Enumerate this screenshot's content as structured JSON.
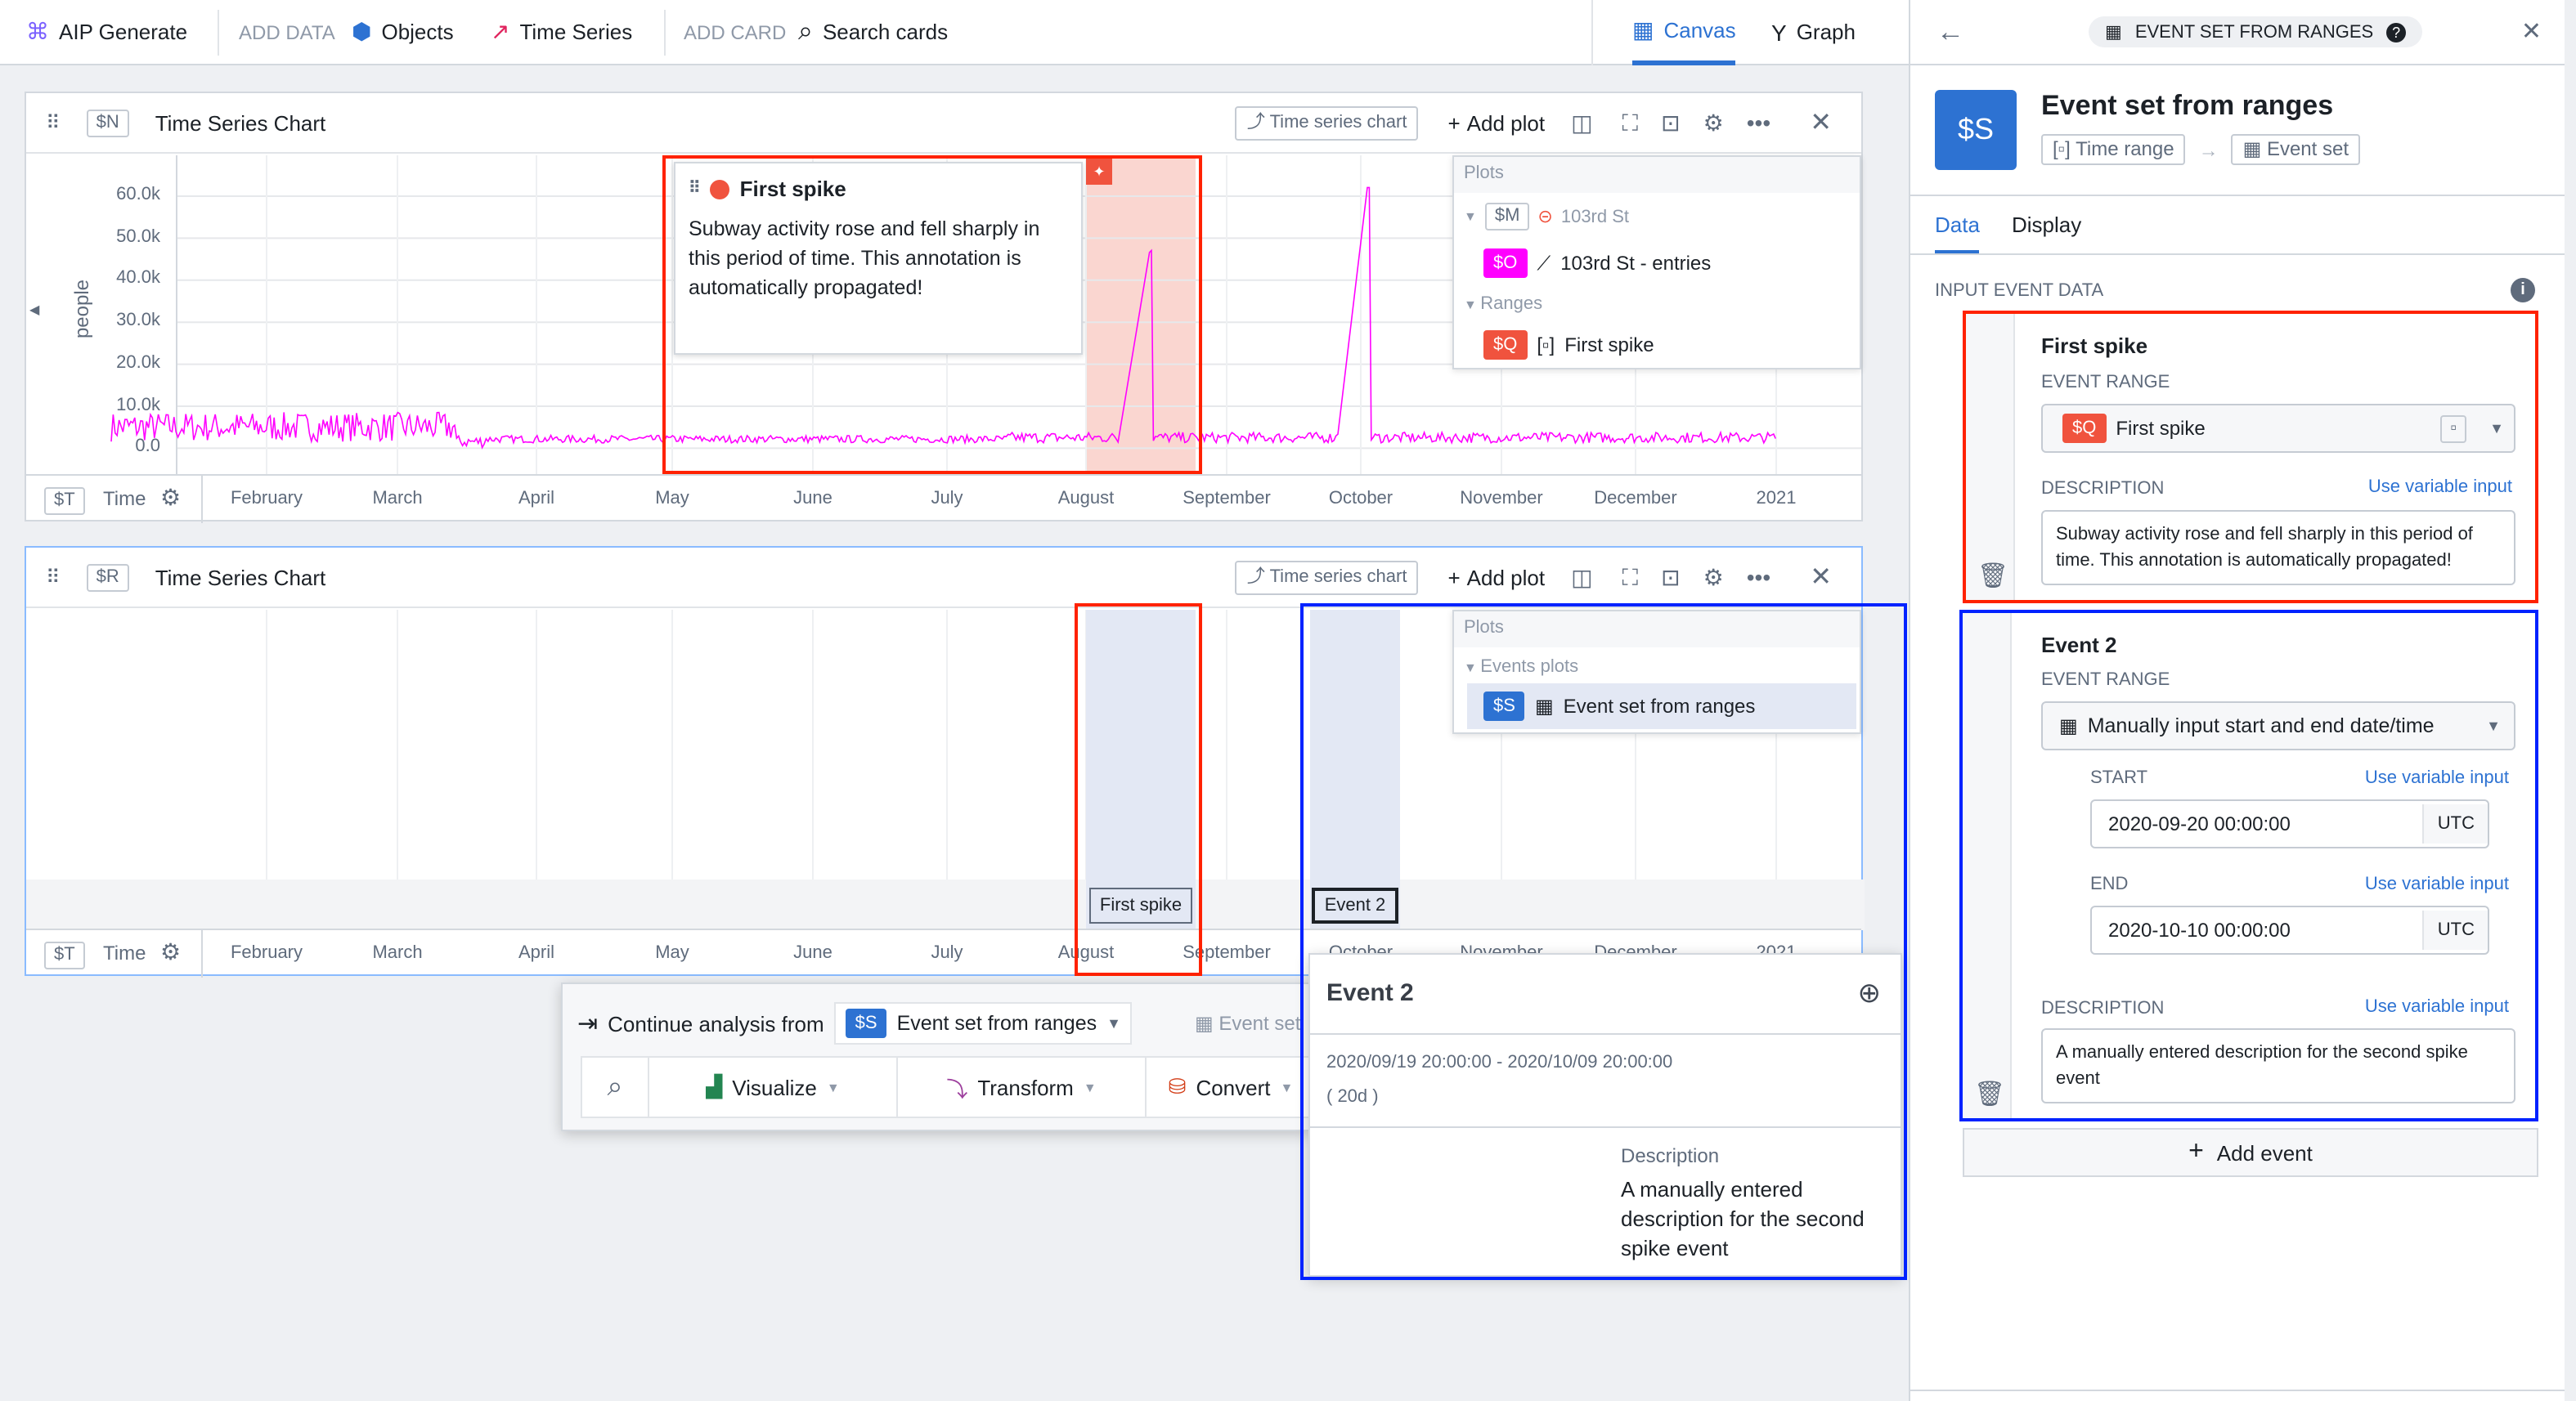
{
  "topbar": {
    "aip": "AIP Generate",
    "add_data": "ADD DATA",
    "objects": "Objects",
    "time_series": "Time Series",
    "add_card": "ADD CARD",
    "search_cards": "Search cards",
    "canvas": "Canvas",
    "graph": "Graph"
  },
  "colors": {
    "accent": "#2d72d2",
    "series": "#ff00ff",
    "range_red": "#f0533e",
    "highlight_red": "#ff2200",
    "highlight_blue": "#0022ff"
  },
  "card1": {
    "id": "$N",
    "title": "Time Series Chart",
    "type_btn": "Time series chart",
    "add_plot": "Add plot",
    "y_axis_label": "people",
    "y_ticks": [
      "60.0k",
      "50.0k",
      "40.0k",
      "30.0k",
      "20.0k",
      "10.0k",
      "0.0"
    ],
    "time_id": "$T",
    "time_label": "Time",
    "months": [
      "February",
      "March",
      "April",
      "May",
      "June",
      "July",
      "August",
      "September",
      "October",
      "November",
      "December",
      "2021"
    ],
    "annotation": {
      "title": "First spike",
      "text": "Subway activity rose and fell sharply in this period of time. This annotation is automatically propagated!"
    },
    "legend": {
      "header": "Plots",
      "group_id": "$M",
      "group_name": "103rd St",
      "series_id": "$O",
      "series_name": "103rd St - entries",
      "ranges_header": "Ranges",
      "range_id": "$Q",
      "range_name": "First spike"
    }
  },
  "card2": {
    "id": "$R",
    "title": "Time Series Chart",
    "type_btn": "Time series chart",
    "add_plot": "Add plot",
    "time_id": "$T",
    "time_label": "Time",
    "months": [
      "February",
      "March",
      "April",
      "May",
      "June",
      "July",
      "August",
      "September",
      "October",
      "November",
      "December",
      "2021"
    ],
    "legend": {
      "header": "Plots",
      "events_header": "Events plots",
      "series_id": "$S",
      "series_name": "Event set from ranges"
    },
    "event_labels": [
      "First spike",
      "Event 2"
    ]
  },
  "continue": {
    "label": "Continue analysis from",
    "id": "$S",
    "value": "Event set from ranges",
    "type": "Event set",
    "visualize": "Visualize",
    "transform": "Transform",
    "convert": "Convert"
  },
  "event_popup": {
    "title": "Event 2",
    "range": "2020/09/19 20:00:00 - 2020/10/09 20:00:00",
    "duration": "( 20d )",
    "desc_label": "Description",
    "desc": "A manually entered description for the second spike event"
  },
  "panel": {
    "crumb": "EVENT SET FROM RANGES",
    "id": "$S",
    "title": "Event set from ranges",
    "input_type": "Time range",
    "output_type": "Event set",
    "tabs": [
      "Data",
      "Display"
    ],
    "section": "INPUT EVENT DATA",
    "events": [
      {
        "name": "First spike",
        "range_label": "EVENT RANGE",
        "range_id": "$Q",
        "range_value": "First spike",
        "desc_label": "DESCRIPTION",
        "use_var": "Use variable input",
        "desc": "Subway activity rose and fell sharply in this period of time. This annotation is automatically propagated!"
      },
      {
        "name": "Event 2",
        "range_label": "EVENT RANGE",
        "range_value": "Manually input start and end date/time",
        "start_label": "START",
        "start": "2020-09-20 00:00:00",
        "end_label": "END",
        "end": "2020-10-10 00:00:00",
        "tz": "UTC",
        "use_var": "Use variable input",
        "desc_label": "DESCRIPTION",
        "desc": "A manually entered description for the second spike event"
      }
    ],
    "add_event": "Add event"
  }
}
